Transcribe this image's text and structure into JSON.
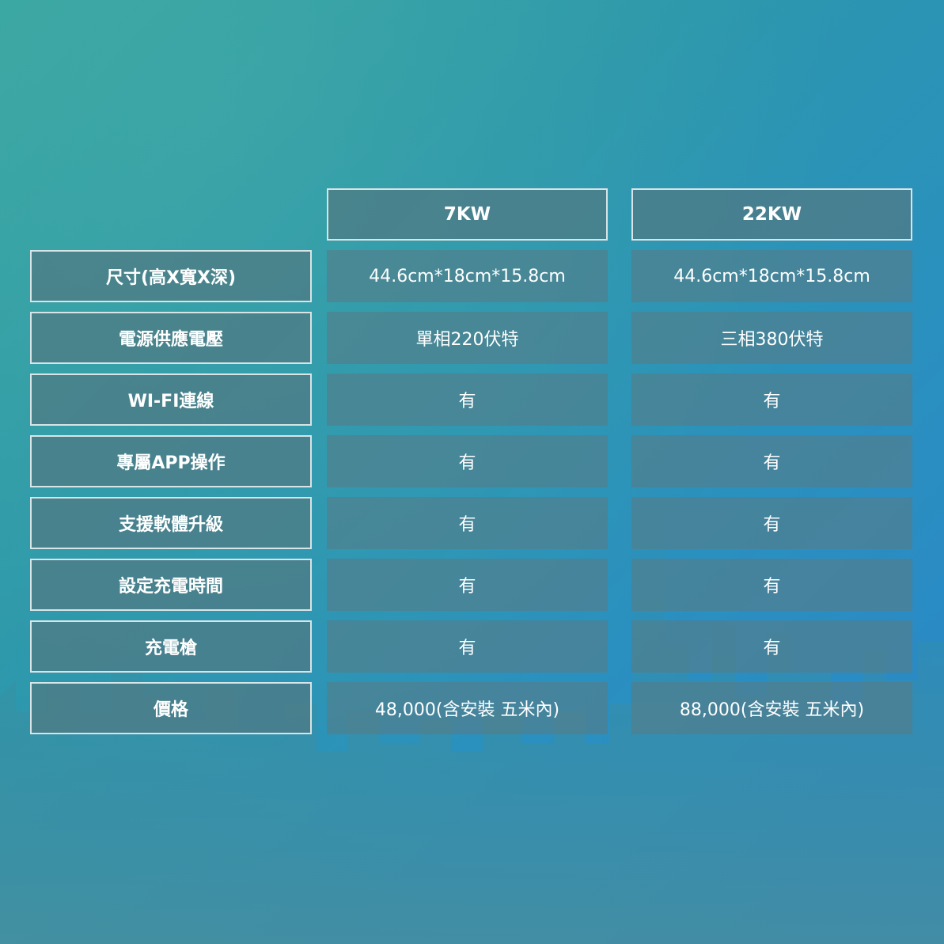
{
  "colors": {
    "background_start": "#36a4a0",
    "background_end": "#2b86c8",
    "cell_fill": "#507882",
    "cell_border": "#d8e4e6",
    "text": "#ffffff"
  },
  "columns": [
    "7KW",
    "22KW"
  ],
  "rows": [
    {
      "label": "尺寸(高X寬X深)",
      "values": [
        "44.6cm*18cm*15.8cm",
        "44.6cm*18cm*15.8cm"
      ]
    },
    {
      "label": "電源供應電壓",
      "values": [
        "單相220伏特",
        "三相380伏特"
      ]
    },
    {
      "label": "WI-FI連線",
      "values": [
        "有",
        "有"
      ]
    },
    {
      "label": "專屬APP操作",
      "values": [
        "有",
        "有"
      ]
    },
    {
      "label": "支援軟體升級",
      "values": [
        "有",
        "有"
      ]
    },
    {
      "label": "設定充電時間",
      "values": [
        "有",
        "有"
      ]
    },
    {
      "label": "充電槍",
      "values": [
        "有",
        "有"
      ]
    },
    {
      "label": "價格",
      "values": [
        "48,000(含安裝 五米內)",
        "88,000(含安裝 五米內)"
      ]
    }
  ]
}
